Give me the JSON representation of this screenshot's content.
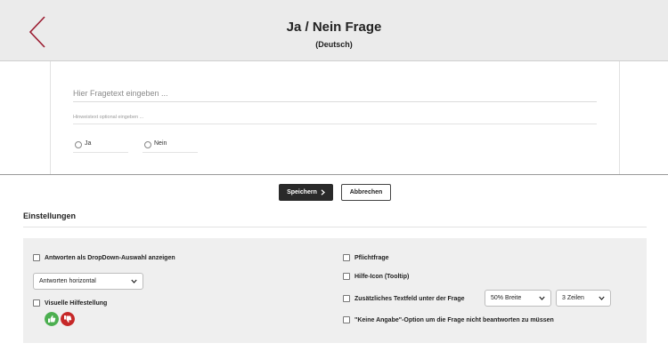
{
  "header": {
    "title": "Ja / Nein Frage",
    "subtitle": "(Deutsch)"
  },
  "preview": {
    "question_placeholder": "Hier Fragetext eingeben ...",
    "hint_placeholder": "Hinweistext optional eingeben ...",
    "answers": [
      "Ja",
      "Nein"
    ]
  },
  "actions": {
    "save_label": "Speichern",
    "cancel_label": "Abbrechen"
  },
  "settings": {
    "title": "Einstellungen",
    "left": {
      "dropdown_option": "Antworten als DropDown-Auswahl anzeigen",
      "layout_select": "Antworten horizontal",
      "visual_help": "Visuelle Hilfestellung"
    },
    "right": {
      "required": "Pflichtfrage",
      "help_icon": "Hilfe-Icon (Tooltip)",
      "extra_textfield": "Zusätzliches Textfeld unter der Frage",
      "width_select": "50% Breite",
      "rows_select": "3 Zeilen",
      "no_answer_option": "\"Keine Angabe\"-Option um die Frage nicht beantworten zu müssen"
    }
  },
  "colors": {
    "back_arrow": "#9b1b30",
    "thumbs_up": "#4caf50",
    "thumbs_down": "#c62828",
    "save_bg": "#2a2a2a"
  },
  "icons": {
    "back": "chevron-left-icon",
    "save_chevron": "chevron-right-icon",
    "thumbs_up": "thumbs-up-icon",
    "thumbs_down": "thumbs-down-icon"
  }
}
